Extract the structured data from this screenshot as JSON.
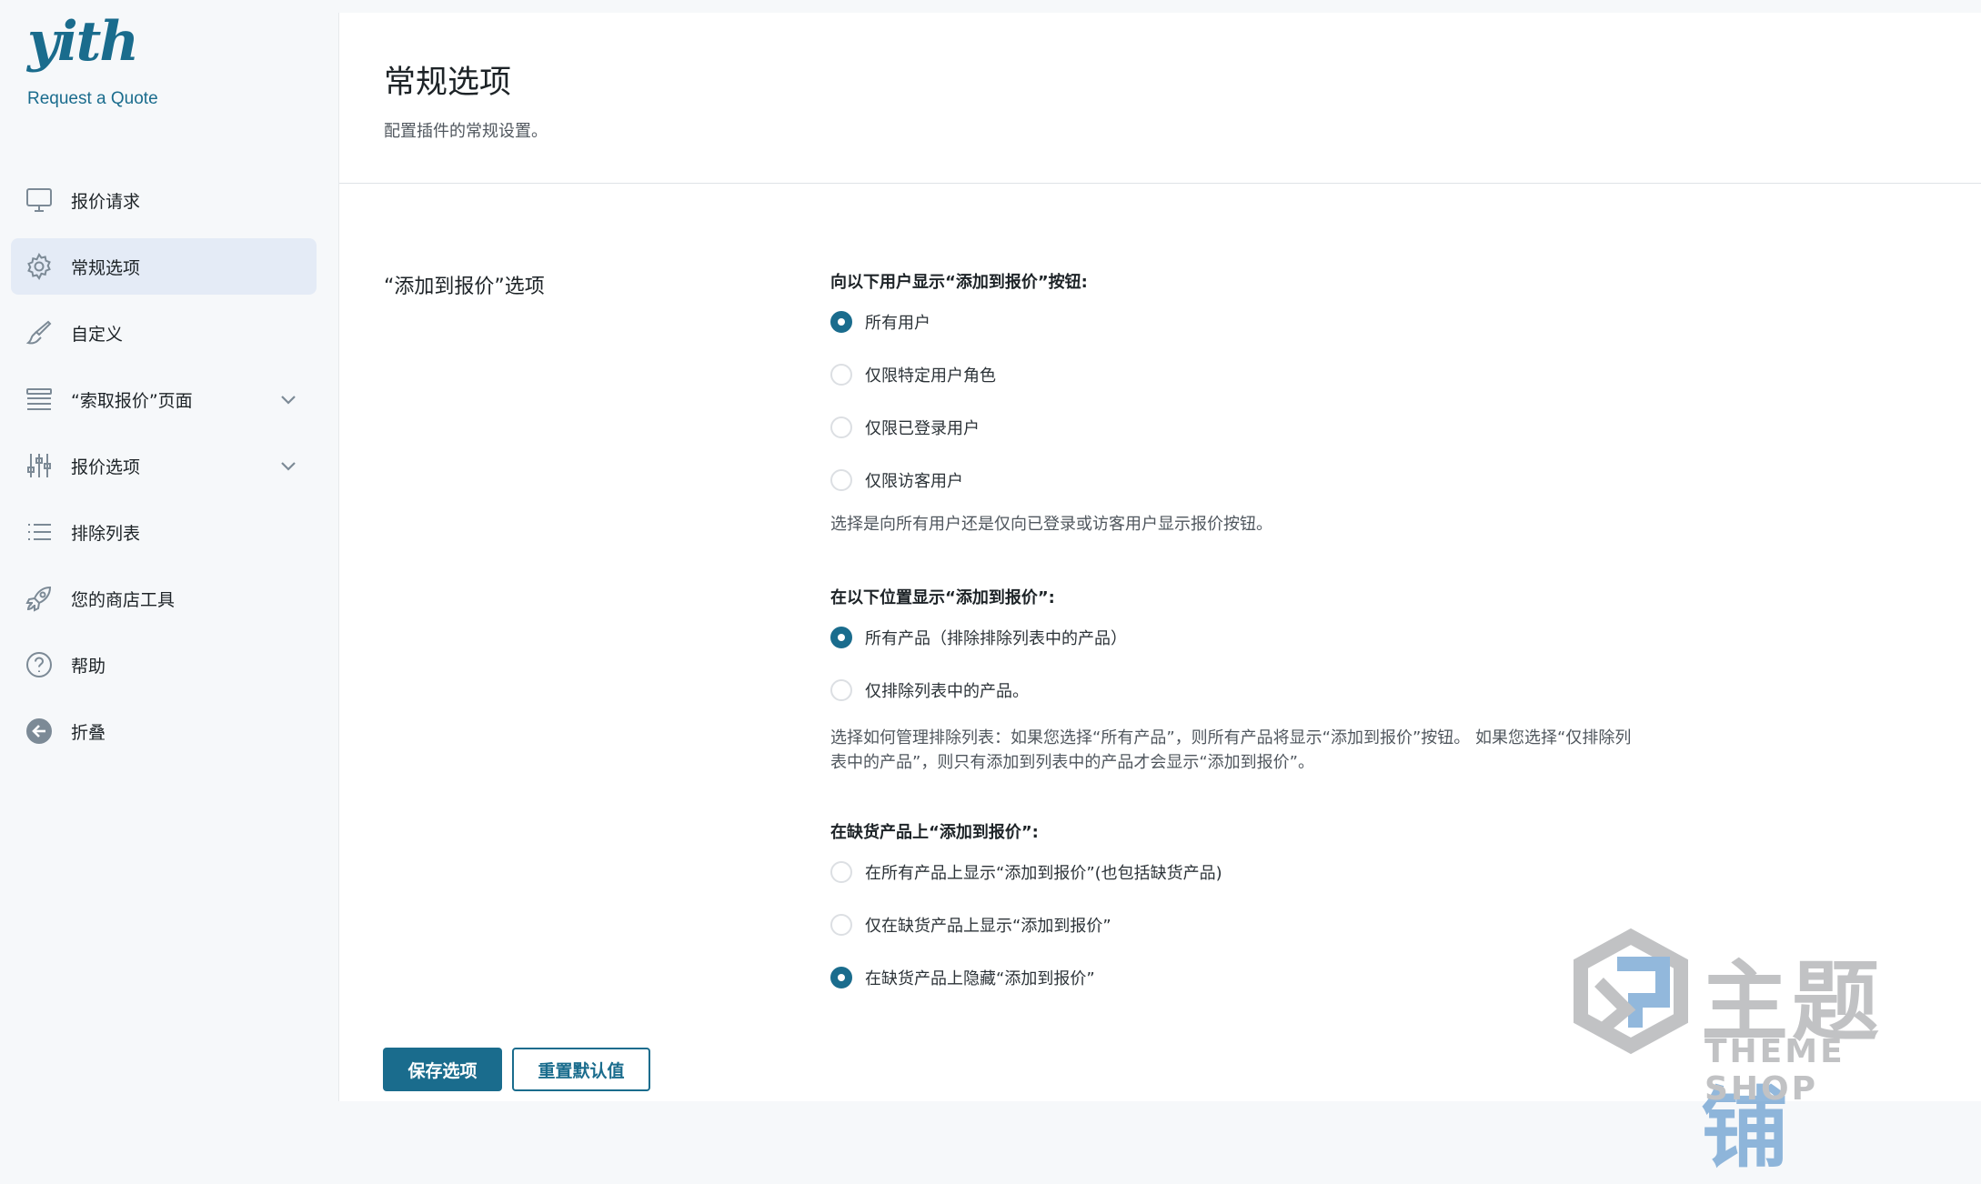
{
  "brand": {
    "logo_text": "yith",
    "plugin_name": "Request a Quote"
  },
  "sidebar": {
    "items": [
      {
        "label": "报价请求",
        "icon": "monitor-icon",
        "active": false
      },
      {
        "label": "常规选项",
        "icon": "gear-icon",
        "active": true
      },
      {
        "label": "自定义",
        "icon": "brush-icon",
        "active": false
      },
      {
        "label": "“索取报价”页面",
        "icon": "list-layout-icon",
        "active": false,
        "expandable": true
      },
      {
        "label": "报价选项",
        "icon": "sliders-icon",
        "active": false,
        "expandable": true
      },
      {
        "label": "排除列表",
        "icon": "bullet-list-icon",
        "active": false
      },
      {
        "label": "您的商店工具",
        "icon": "rocket-icon",
        "active": false
      },
      {
        "label": "帮助",
        "icon": "help-circle-icon",
        "active": false
      },
      {
        "label": "折叠",
        "icon": "collapse-arrow-icon",
        "active": false
      }
    ]
  },
  "page": {
    "title": "常规选项",
    "description": "配置插件的常规设置。"
  },
  "section": {
    "label": "“添加到报价”选项"
  },
  "groups": {
    "show_to": {
      "heading": "向以下用户显示“添加到报价”按钮:",
      "options": [
        "所有用户",
        "仅限特定用户角色",
        "仅限已登录用户",
        "仅限访客用户"
      ],
      "selected_index": 0,
      "help": "选择是向所有用户还是仅向已登录或访客用户显示报价按钮。"
    },
    "show_on": {
      "heading": "在以下位置显示“添加到报价”:",
      "options": [
        "所有产品（排除排除列表中的产品）",
        "仅排除列表中的产品。"
      ],
      "selected_index": 0,
      "help": "选择如何管理排除列表：如果您选择“所有产品”，则所有产品将显示“添加到报价”按钮。 如果您选择“仅排除列表中的产品”，则只有添加到列表中的产品才会显示“添加到报价”。"
    },
    "out_of_stock": {
      "heading": "在缺货产品上“添加到报价”:",
      "options": [
        "在所有产品上显示“添加到报价”(也包括缺货产品)",
        "仅在缺货产品上显示“添加到报价”",
        "在缺货产品上隐藏“添加到报价”"
      ],
      "selected_index": 2
    }
  },
  "buttons": {
    "save": "保存选项",
    "reset": "重置默认值"
  },
  "watermark": {
    "main_gray": "主题",
    "main_blue": "铺",
    "sub": "THEME SHOP"
  },
  "colors": {
    "accent": "#1a6c8d",
    "active_nav_bg": "#e4ebf6",
    "page_bg": "#f6f8fa"
  }
}
